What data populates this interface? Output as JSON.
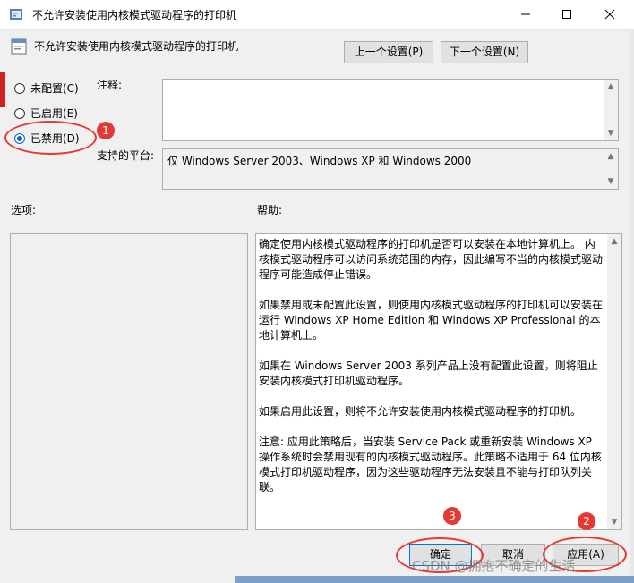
{
  "window": {
    "title": "不允许安装使用内核模式驱动程序的打印机",
    "minimize_icon": "minimize-icon",
    "maximize_icon": "maximize-icon",
    "close_icon": "close-icon"
  },
  "header": {
    "policy_name": "不允许安装使用内核模式驱动程序的打印机",
    "prev_button": "上一个设置(P)",
    "next_button": "下一个设置(N)"
  },
  "state_options": [
    {
      "label": "未配置(C)",
      "checked": false
    },
    {
      "label": "已启用(E)",
      "checked": false
    },
    {
      "label": "已禁用(D)",
      "checked": true
    }
  ],
  "comment": {
    "label": "注释:",
    "value": ""
  },
  "supported": {
    "label": "支持的平台:",
    "value": "仅 Windows Server 2003、Windows XP 和 Windows 2000"
  },
  "options_label": "选项:",
  "help_label": "帮助:",
  "help_paragraphs": [
    "确定使用内核模式驱动程序的打印机是否可以安装在本地计算机上。 内核模式驱动程序可以访问系统范围的内存，因此编写不当的内核模式驱动程序可能造成停止错误。",
    "如果禁用或未配置此设置，则使用内核模式驱动程序的打印机可以安装在运行 Windows XP Home Edition 和 Windows XP Professional 的本地计算机上。",
    "如果在 Windows Server 2003 系列产品上没有配置此设置，则将阻止安装内核模式打印机驱动程序。",
    "如果启用此设置，则将不允许安装使用内核模式驱动程序的打印机。",
    "注意: 应用此策略后，当安装 Service Pack 或重新安装 Windows XP 操作系统时会禁用现有的内核模式驱动程序。此策略不适用于 64 位内核模式打印机驱动程序，因为这些驱动程序无法安装且不能与打印队列关联。"
  ],
  "footer": {
    "ok_button": "确定",
    "cancel_button": "取消",
    "apply_button": "应用(A)"
  },
  "annotations": [
    "1",
    "2",
    "3"
  ],
  "annotation_color": "#e53935",
  "watermark": "CSDN @拥抱不确定的生活"
}
